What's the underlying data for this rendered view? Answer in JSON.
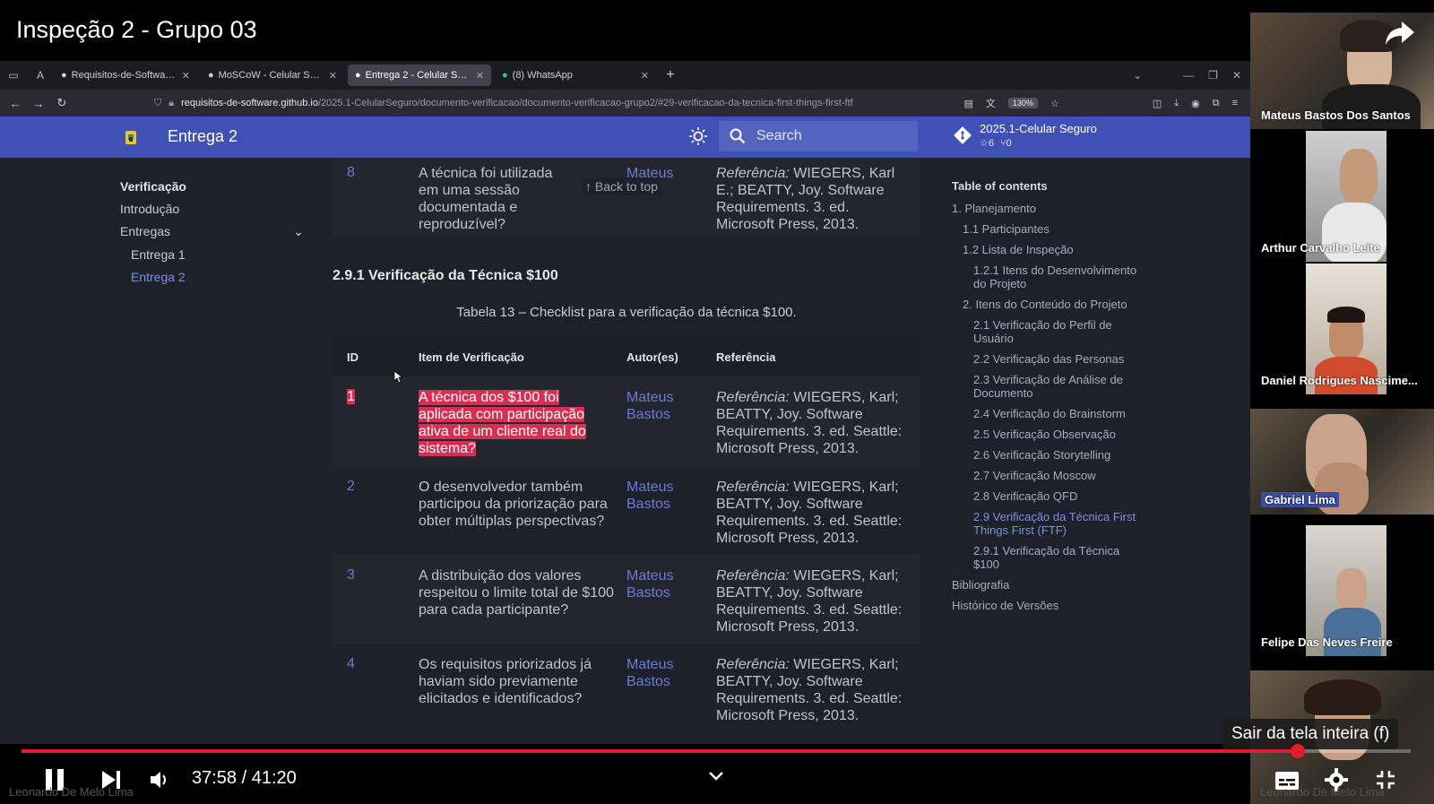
{
  "video": {
    "title": "Inspeção 2 - Grupo 03",
    "time_current": "37:58",
    "time_total": "41:20",
    "progress": 0.919,
    "tooltip": "Sair da tela inteira (f)",
    "watermark": "Leonardo De Melo Lima"
  },
  "browser": {
    "tabs": [
      {
        "label": "Requisitos-de-Software/2",
        "icon": "github-icon"
      },
      {
        "label": "MoSCoW - Celular Seguro",
        "icon": "site-icon"
      },
      {
        "label": "Entrega 2 - Celular Segur",
        "icon": "site-icon",
        "active": true
      },
      {
        "label": "(8) WhatsApp",
        "icon": "whatsapp-icon"
      }
    ],
    "url_domain": "requisitos-de-software.github.io",
    "url_path": "/2025.1-CelularSeguro/documento-verificacao/documento-verificacao-grupo2/#29-verificacao-da-tecnica-first-things-first-ftf",
    "zoom": "130%"
  },
  "site": {
    "title": "Entrega 2",
    "search_placeholder": "Search",
    "repo_name": "2025.1-Celular Seguro",
    "repo_stars": "6",
    "repo_forks": "0"
  },
  "sidenav": {
    "heading": "Verificação",
    "items": [
      "Introdução",
      "Entregas",
      "Entrega 1",
      "Entrega 2"
    ]
  },
  "main": {
    "prev_row": {
      "id": "8",
      "item": "A técnica foi utilizada em uma sessão documentada e reproduzível?",
      "author": "Mateus",
      "ref_label": "Referência:",
      "ref_text": " WIEGERS, Karl E.; BEATTY, Joy. Software Requirements. 3. ed. Microsoft Press, 2013."
    },
    "back_to_top": "Back to top",
    "section_title": "2.9.1 Verificação da Técnica $100",
    "caption": "Tabela 13 – Checklist para a verificação da técnica $100.",
    "headers": [
      "ID",
      "Item de Verificação",
      "Autor(es)",
      "Referência"
    ],
    "rows": [
      {
        "id": "1",
        "item": "A técnica dos $100 foi aplicada com participação ativa de um cliente real do sistema?",
        "author": "Mateus Bastos",
        "ref_label": "Referência:",
        "ref_text": " WIEGERS, Karl; BEATTY, Joy. Software Requirements. 3. ed. Seattle: Microsoft Press, 2013."
      },
      {
        "id": "2",
        "item": "O desenvolvedor também participou da priorização para obter múltiplas perspectivas?",
        "author": "Mateus Bastos",
        "ref_label": "Referência:",
        "ref_text": " WIEGERS, Karl; BEATTY, Joy. Software Requirements. 3. ed. Seattle: Microsoft Press, 2013."
      },
      {
        "id": "3",
        "item": "A distribuição dos valores respeitou o limite total de $100 para cada participante?",
        "author": "Mateus Bastos",
        "ref_label": "Referência:",
        "ref_text": " WIEGERS, Karl; BEATTY, Joy. Software Requirements. 3. ed. Seattle: Microsoft Press, 2013."
      },
      {
        "id": "4",
        "item": "Os requisitos priorizados já haviam sido previamente elicitados e identificados?",
        "author": "Mateus Bastos",
        "ref_label": "Referência:",
        "ref_text": " WIEGERS, Karl; BEATTY, Joy. Software Requirements. 3. ed. Seattle: Microsoft Press, 2013."
      }
    ]
  },
  "toc": {
    "heading": "Table of contents",
    "items": [
      {
        "label": "1. Planejamento",
        "level": 1
      },
      {
        "label": "1.1 Participantes",
        "level": 2
      },
      {
        "label": "1.2 Lista de Inspeção",
        "level": 2
      },
      {
        "label": "1.2.1 Itens do Desenvolvimento do Projeto",
        "level": 3
      },
      {
        "label": "2. Itens do Conteúdo do Projeto",
        "level": 2
      },
      {
        "label": "2.1 Verificação do Perfil de Usuário",
        "level": 3
      },
      {
        "label": "2.2 Verificação das Personas",
        "level": 3
      },
      {
        "label": "2.3 Verificação de Análise de Documento",
        "level": 3
      },
      {
        "label": "2.4 Verificação do Brainstorm",
        "level": 3
      },
      {
        "label": "2.5 Verificação Observação",
        "level": 3
      },
      {
        "label": "2.6 Verificação Storytelling",
        "level": 3
      },
      {
        "label": "2.7 Verificação Moscow",
        "level": 3
      },
      {
        "label": "2.8 Verificação QFD",
        "level": 3
      },
      {
        "label": "2.9 Verificação da Técnica First Things First (FTF)",
        "level": 3,
        "active": true
      },
      {
        "label": "2.9.1 Verificação da Técnica $100",
        "level": 3
      },
      {
        "label": "Bibliografia",
        "level": 1
      },
      {
        "label": "Histórico de Versões",
        "level": 1
      }
    ]
  },
  "participants": [
    {
      "name": "Mateus Bastos Dos Santos"
    },
    {
      "name": "Arthur Carvalho Leite"
    },
    {
      "name": "Daniel Rodrigues Nascime..."
    },
    {
      "name": "Gabriel Lima",
      "active_speaker": true
    },
    {
      "name": "Felipe Das Neves Freire"
    },
    {
      "name": ""
    }
  ],
  "colors": {
    "header": "#4051b5",
    "link": "#6a7bd6",
    "highlight": "#d62f52",
    "progress": "#e01e2c"
  }
}
